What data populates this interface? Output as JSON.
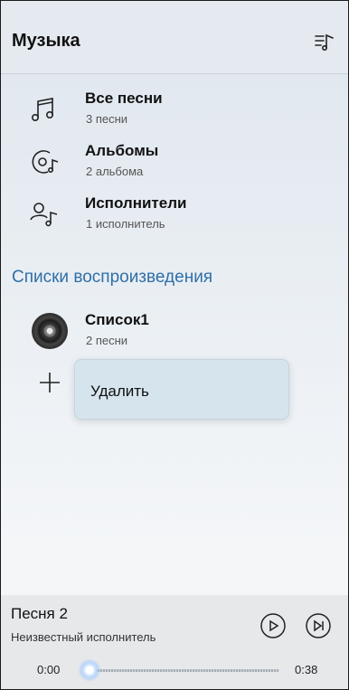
{
  "header": {
    "title": "Музыка",
    "action_icon": "playlist-music-icon"
  },
  "library": [
    {
      "icon": "music-notes-icon",
      "label": "Все песни",
      "count": "3 песни"
    },
    {
      "icon": "album-disc-icon",
      "label": "Альбомы",
      "count": "2 альбома"
    },
    {
      "icon": "artist-note-icon",
      "label": "Исполнители",
      "count": "1 исполнитель"
    }
  ],
  "playlists": {
    "title": "Списки воспроизведения",
    "items": [
      {
        "label": "Список1",
        "count": "2 песни"
      }
    ],
    "add_icon": "plus-icon"
  },
  "context_menu": {
    "delete_label": "Удалить"
  },
  "player": {
    "song": "Песня 2",
    "artist": "Неизвестный исполнитель",
    "time_current": "0:00",
    "time_total": "0:38",
    "progress": 0,
    "play_icon": "play-icon",
    "next_icon": "skip-next-icon"
  },
  "colors": {
    "accent": "#2f6fa7",
    "popup_bg": "#d6e4ee"
  }
}
